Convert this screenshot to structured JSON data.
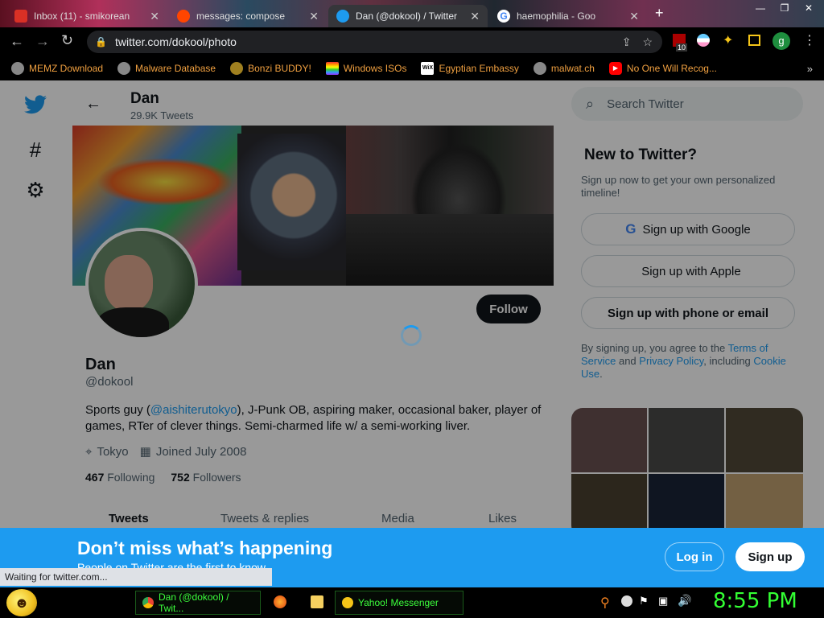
{
  "browser": {
    "tabs": [
      {
        "label": "Inbox (11) - smikorean",
        "favicon_color": "#d93025",
        "active": false
      },
      {
        "label": "messages: compose",
        "favicon_color": "#ff4500",
        "active": false
      },
      {
        "label": "Dan (@dokool) / Twitter",
        "favicon_color": "#1d9bf0",
        "active": true
      },
      {
        "label": "haemophilia - Goo",
        "favicon_color": "#4285f4",
        "active": false
      }
    ],
    "new_tab": "+",
    "url": "twitter.com/dokool/photo",
    "extension_badge": "10",
    "profile_initial": "g"
  },
  "bookmarks": [
    {
      "label": "MEMZ Download",
      "icon": "globe-icon",
      "color": "#888"
    },
    {
      "label": "Malware Database",
      "icon": "globe-icon",
      "color": "#888"
    },
    {
      "label": "Bonzi BUDDY!",
      "icon": "bonzi-icon",
      "color": "#a08020"
    },
    {
      "label": "Windows ISOs",
      "icon": "rainbow-icon",
      "color": "#e04080"
    },
    {
      "label": "Egyptian Embassy",
      "icon": "wix-icon",
      "color": "#ffffff"
    },
    {
      "label": "malwat.ch",
      "icon": "globe-icon",
      "color": "#888"
    },
    {
      "label": "No One Will Recog...",
      "icon": "youtube-icon",
      "color": "#ff0000"
    }
  ],
  "profile": {
    "name": "Dan",
    "tweet_count": "29.9K Tweets",
    "handle": "@dokool",
    "follow_label": "Follow",
    "bio_pre": "Sports guy (",
    "bio_mention": "@aishiterutokyo",
    "bio_post": "), J-Punk OB, aspiring maker, occasional baker, player of games, RTer of clever things. Semi-charmed life w/ a semi-working liver.",
    "location": "Tokyo",
    "joined": "Joined July 2008",
    "following_count": "467",
    "following_label": "Following",
    "followers_count": "752",
    "followers_label": "Followers",
    "tabs": [
      "Tweets",
      "Tweets & replies",
      "Media",
      "Likes"
    ]
  },
  "sidebar": {
    "search_placeholder": "Search Twitter",
    "new_title": "New to Twitter?",
    "new_sub": "Sign up now to get your own personalized timeline!",
    "google_label": "Sign up with Google",
    "apple_label": "Sign up with Apple",
    "phone_label": "Sign up with phone or email",
    "terms_pre": "By signing up, you agree to the ",
    "terms_link": "Terms of Service",
    "terms_mid": " and ",
    "privacy_link": "Privacy Policy",
    "terms_mid2": ", including ",
    "cookie_link": "Cookie Use",
    "terms_end": "."
  },
  "banner": {
    "title": "Don’t miss what’s happening",
    "subtitle": "People on Twitter are the first to know.",
    "login_label": "Log in",
    "signup_label": "Sign up"
  },
  "status_text": "Waiting for twitter.com...",
  "taskbar": {
    "chrome_item": "Dan (@dokool) / Twit...",
    "yahoo_item": "Yahoo! Messenger",
    "clock": "8:55 PM"
  },
  "colors": {
    "twitter_blue": "#1d9bf0",
    "clock_green": "#33ff33"
  }
}
